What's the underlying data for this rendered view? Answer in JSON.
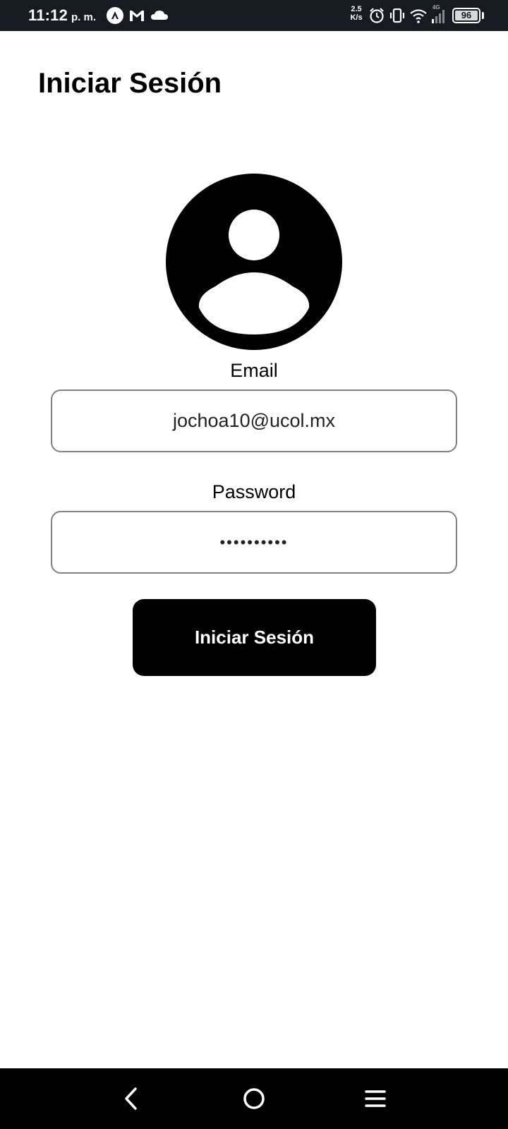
{
  "status_bar": {
    "time": "11:12",
    "ampm": "p. m.",
    "net_speed_value": "2.5",
    "net_speed_unit": "K/s",
    "network_type": "4G",
    "battery_level": "96",
    "icons": [
      "notification-app-icon",
      "gmail-icon",
      "cloud-icon",
      "alarm-icon",
      "vibrate-icon",
      "wifi-icon",
      "signal-icon",
      "battery-icon"
    ]
  },
  "header": {
    "title": "Iniciar Sesión"
  },
  "avatar": {
    "icon": "user-avatar-icon"
  },
  "form": {
    "email_label": "Email",
    "email_value": "jochoa10@ucol.mx",
    "password_label": "Password",
    "password_value": "••••••••••",
    "submit_label": "Iniciar Sesión"
  },
  "nav_bar": {
    "icons": [
      "back-icon",
      "home-icon",
      "menu-icon"
    ]
  },
  "colors": {
    "status_bar_bg": "#161b22",
    "background": "#ffffff",
    "button_bg": "#000000",
    "field_border": "#808080"
  }
}
